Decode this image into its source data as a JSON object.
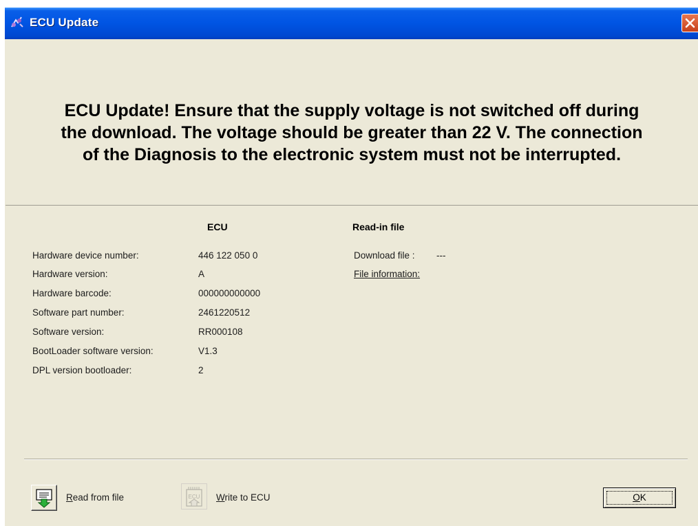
{
  "window": {
    "title": "ECU Update",
    "app_icon": "ecu-update-app-icon",
    "close_icon": "close-icon",
    "titlebar_color": "#0054e3",
    "close_color": "#c6411b"
  },
  "warning": {
    "line1": "ECU Update! Ensure that the supply voltage is not switched off during",
    "line2": "the download. The voltage should be greater than 22 V. The connection",
    "line3": "of the Diagnosis to the electronic system must not be interrupted."
  },
  "ecu": {
    "header": "ECU",
    "rows": [
      {
        "label": "Hardware device number:",
        "value": "446 122 050 0"
      },
      {
        "label": "Hardware version:",
        "value": "A"
      },
      {
        "label": "Hardware barcode:",
        "value": "000000000000"
      },
      {
        "label": "Software part number:",
        "value": "2461220512"
      },
      {
        "label": "Software version:",
        "value": "RR000108"
      },
      {
        "label": "BootLoader software version:",
        "value": "V1.3"
      },
      {
        "label": "DPL version bootloader:",
        "value": "2"
      }
    ]
  },
  "readin": {
    "header": "Read-in file",
    "download_label": "Download file :",
    "download_value": "---",
    "file_info_link": "File information:"
  },
  "buttons": {
    "read_mnemonic": "R",
    "read_rest": "ead from file",
    "read_icon": "read-from-file-icon",
    "write_mnemonic": "W",
    "write_rest": "rite to ECU",
    "write_icon": "write-to-ecu-icon",
    "ok_mnemonic": "O",
    "ok_rest": "K"
  }
}
